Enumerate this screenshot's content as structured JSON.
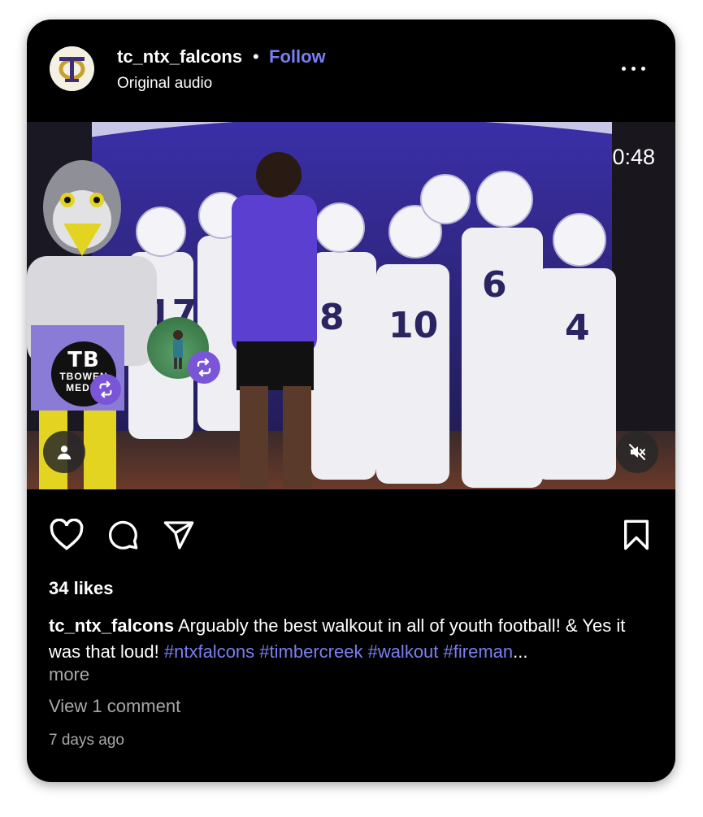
{
  "post": {
    "username": "tc_ntx_falcons",
    "separator": "•",
    "follow_label": "Follow",
    "audio": "Original audio",
    "avatar_letters": "TC",
    "avatar_icon": "tc-monogram-logo",
    "more_icon": "more-horizontal-icon"
  },
  "media": {
    "duration": "0:48",
    "watermark_line1": "TB",
    "watermark_line2": "TBOWEN",
    "watermark_line3": "MEDIA",
    "tagged_icon": "user-tag-icon",
    "mute_icon": "speaker-muted-icon",
    "repost_icon": "repost-icon"
  },
  "actions": {
    "like_icon": "heart-icon",
    "comment_icon": "comment-bubble-icon",
    "share_icon": "paper-plane-icon",
    "save_icon": "bookmark-icon"
  },
  "likes": "34 likes",
  "caption": {
    "username": "tc_ntx_falcons",
    "text": "Arguably the best walkout in all of youth football! & Yes it was that loud!",
    "hashtags": [
      "#ntxfalcons",
      "#timbercreek",
      "#walkout",
      "#fireman"
    ],
    "ellipsis": "...",
    "more": "more"
  },
  "view_comments": "View 1 comment",
  "time_ago": "7 days ago",
  "colors": {
    "background": "#000000",
    "accent": "#7a7ff0",
    "muted_text": "#a8a8a8",
    "repost_badge": "#7a55d8"
  }
}
